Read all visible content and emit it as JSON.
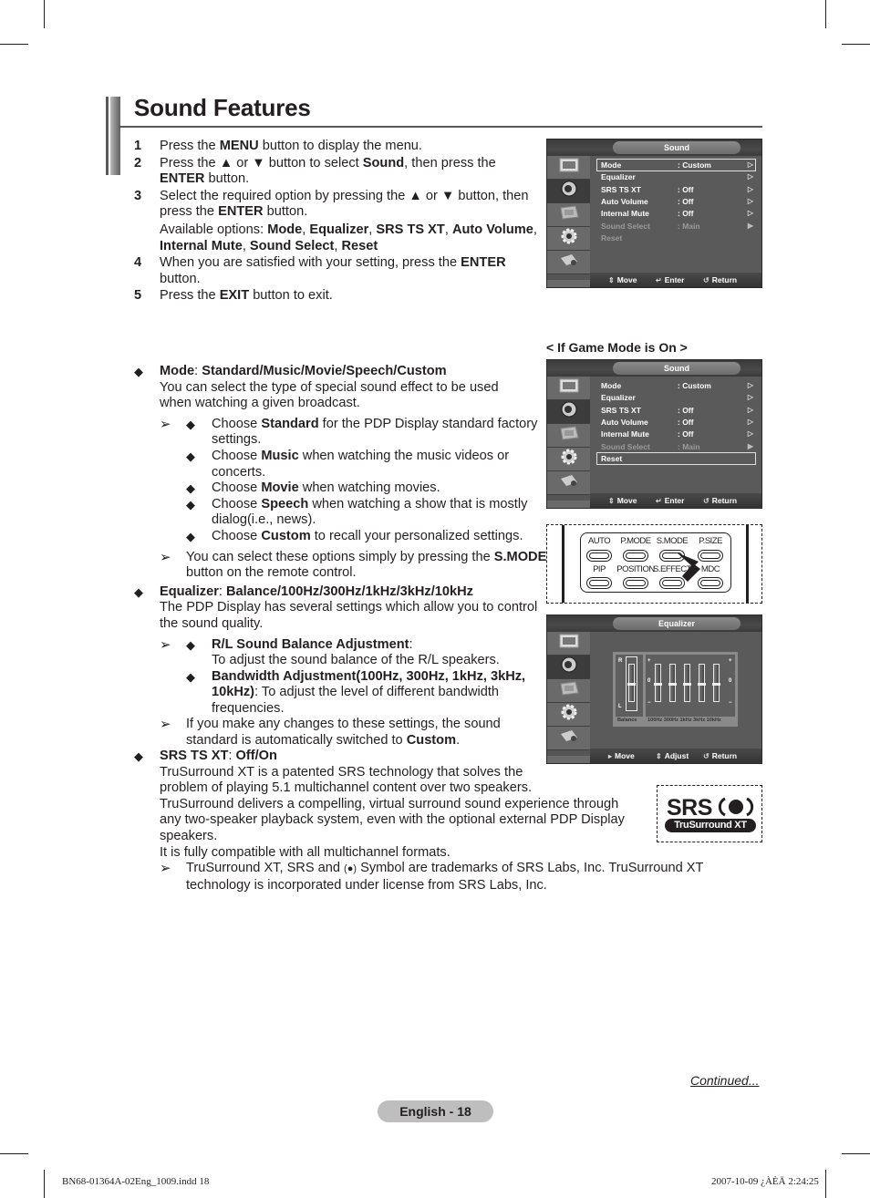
{
  "page": {
    "title": "Sound Features",
    "continued": "Continued...",
    "page_label": "English - 18",
    "slug_file": "BN68-01364A-02Eng_1009.indd   18",
    "slug_timestamp": "2007-10-09   ¿ÀÈÄ 2:24:25"
  },
  "steps": [
    {
      "num": "1",
      "parts": [
        "Press the ",
        "MENU",
        " button to display the menu."
      ]
    },
    {
      "num": "2",
      "parts": [
        "Press the ▲ or ▼ button to select ",
        "Sound",
        ", then press the ",
        "ENTER",
        " button."
      ]
    },
    {
      "num": "3",
      "parts": [
        "Select the required option by pressing the ▲ or ▼ button, then press the ",
        "ENTER",
        " button."
      ],
      "sub_parts": [
        "Available options: ",
        "Mode",
        ", ",
        "Equalizer",
        ", ",
        "SRS TS XT",
        ", ",
        "Auto Volume",
        ", ",
        "Internal Mute",
        ", ",
        "Sound Select",
        ", ",
        "Reset"
      ]
    },
    {
      "num": "4",
      "parts": [
        "When you are satisfied with your setting, press the ",
        "ENTER",
        " button."
      ]
    },
    {
      "num": "5",
      "parts": [
        "Press the ",
        "EXIT",
        " button to exit."
      ]
    }
  ],
  "game_mode_label": "< If Game Mode is On >",
  "features": {
    "mode": {
      "heading_name": "Mode",
      "heading_values": "Standard/Music/Movie/Speech/Custom",
      "desc": "You can select the type of special sound effect to be used when watching a given broadcast.",
      "options": [
        {
          "pre": "Choose ",
          "bold": "Standard",
          "post": " for the PDP Display standard factory settings."
        },
        {
          "pre": "Choose ",
          "bold": "Music",
          "post": " when watching the music videos or concerts."
        },
        {
          "pre": "Choose ",
          "bold": "Movie",
          "post": " when watching movies."
        },
        {
          "pre": "Choose ",
          "bold": "Speech",
          "post": " when watching a show that is mostly dialog(i.e., news)."
        },
        {
          "pre": "Choose ",
          "bold": "Custom",
          "post": " to recall your personalized settings."
        }
      ],
      "note_pre": "You can select these options simply by pressing the ",
      "note_bold": "S.MODE",
      "note_post": " button on the remote control."
    },
    "equalizer": {
      "heading_name": "Equalizer",
      "heading_values": "Balance/100Hz/300Hz/1kHz/3kHz/10kHz",
      "desc": "The PDP Display has several settings which allow you to control the sound quality.",
      "items": [
        {
          "bold": "R/L Sound Balance Adjustment",
          "post_bold": ":",
          "line2": "To adjust the sound balance of the R/L speakers."
        },
        {
          "bold": "Bandwidth Adjustment(100Hz, 300Hz, 1kHz, 3kHz, 10kHz)",
          "post_bold": ": To adjust the level of different bandwidth frequencies."
        }
      ],
      "note_pre": "If you make any changes to these settings, the sound standard is automatically switched to ",
      "note_bold": "Custom",
      "note_post": "."
    },
    "srs": {
      "heading_name": "SRS TS XT",
      "heading_values": "Off/On",
      "lines": [
        "TruSurround XT is a patented SRS technology that solves the",
        "problem of playing 5.1 multichannel content over two speakers.",
        "TruSurround delivers a compelling, virtual surround  sound experience through",
        "any two-speaker playback system, even with the optional external PDP Display",
        "speakers.",
        "It is fully compatible with all multichannel formats."
      ],
      "note_pre": "TruSurround XT, SRS and ",
      "note_symbol": "(●)",
      "note_post": " Symbol are trademarks of SRS Labs, Inc. TruSurround XT technology is incorporated under license from SRS Labs, Inc."
    }
  },
  "osd_sound": {
    "title": "Sound",
    "rows": [
      {
        "label": "Mode",
        "value": ": Custom",
        "arrow": "▷",
        "state": "selected"
      },
      {
        "label": "Equalizer",
        "value": "",
        "arrow": "▷",
        "state": "normal"
      },
      {
        "label": "SRS TS XT",
        "value": ": Off",
        "arrow": "▷",
        "state": "normal"
      },
      {
        "label": "Auto Volume",
        "value": ": Off",
        "arrow": "▷",
        "state": "normal"
      },
      {
        "label": "Internal Mute",
        "value": ": Off",
        "arrow": "▷",
        "state": "normal"
      },
      {
        "label": "Sound Select",
        "value": ": Main",
        "arrow": "▶",
        "state": "disabled"
      },
      {
        "label": "Reset",
        "value": "",
        "arrow": "",
        "state": "disabled"
      }
    ],
    "footer": [
      {
        "icon": "⇕",
        "label": "Move"
      },
      {
        "icon": "↵",
        "label": "Enter"
      },
      {
        "icon": "↺",
        "label": "Return"
      }
    ]
  },
  "osd_sound_game": {
    "title": "Sound",
    "rows": [
      {
        "label": "Mode",
        "value": ": Custom",
        "arrow": "▷",
        "state": "normal"
      },
      {
        "label": "Equalizer",
        "value": "",
        "arrow": "▷",
        "state": "normal"
      },
      {
        "label": "SRS TS XT",
        "value": ": Off",
        "arrow": "▷",
        "state": "normal"
      },
      {
        "label": "Auto Volume",
        "value": ": Off",
        "arrow": "▷",
        "state": "normal"
      },
      {
        "label": "Internal Mute",
        "value": ": Off",
        "arrow": "▷",
        "state": "normal"
      },
      {
        "label": "Sound Select",
        "value": ": Main",
        "arrow": "▶",
        "state": "disabled"
      },
      {
        "label": "Reset",
        "value": "",
        "arrow": "",
        "state": "selected"
      }
    ],
    "footer": [
      {
        "icon": "⇕",
        "label": "Move"
      },
      {
        "icon": "↵",
        "label": "Enter"
      },
      {
        "icon": "↺",
        "label": "Return"
      }
    ]
  },
  "osd_equalizer": {
    "title": "Equalizer",
    "balance_top": "R",
    "balance_bottom": "L",
    "band_plus": "+",
    "band_zero": "0",
    "band_minus": "−",
    "balance_caption": "Balance",
    "bands_caption": "100Hz 300Hz 1kHz 3kHz 10kHz",
    "balance_level": 0,
    "band_levels": [
      0,
      0,
      0,
      0,
      0
    ],
    "footer": [
      {
        "icon": "▸",
        "label": "Move"
      },
      {
        "icon": "⇕",
        "label": "Adjust"
      },
      {
        "icon": "↺",
        "label": "Return"
      }
    ]
  },
  "osd_sidebar_icons": [
    "picture-icon",
    "sound-icon",
    "channel-icon",
    "setup-icon",
    "input-icon"
  ],
  "remote": {
    "row1": [
      "AUTO",
      "P.MODE",
      "S.MODE",
      "P.SIZE"
    ],
    "row2": [
      "PIP",
      "POSITION",
      "S.EFFECT",
      "MDC"
    ]
  },
  "srs_logo": {
    "word": "SRS",
    "tagline": "TruSurround XT"
  }
}
